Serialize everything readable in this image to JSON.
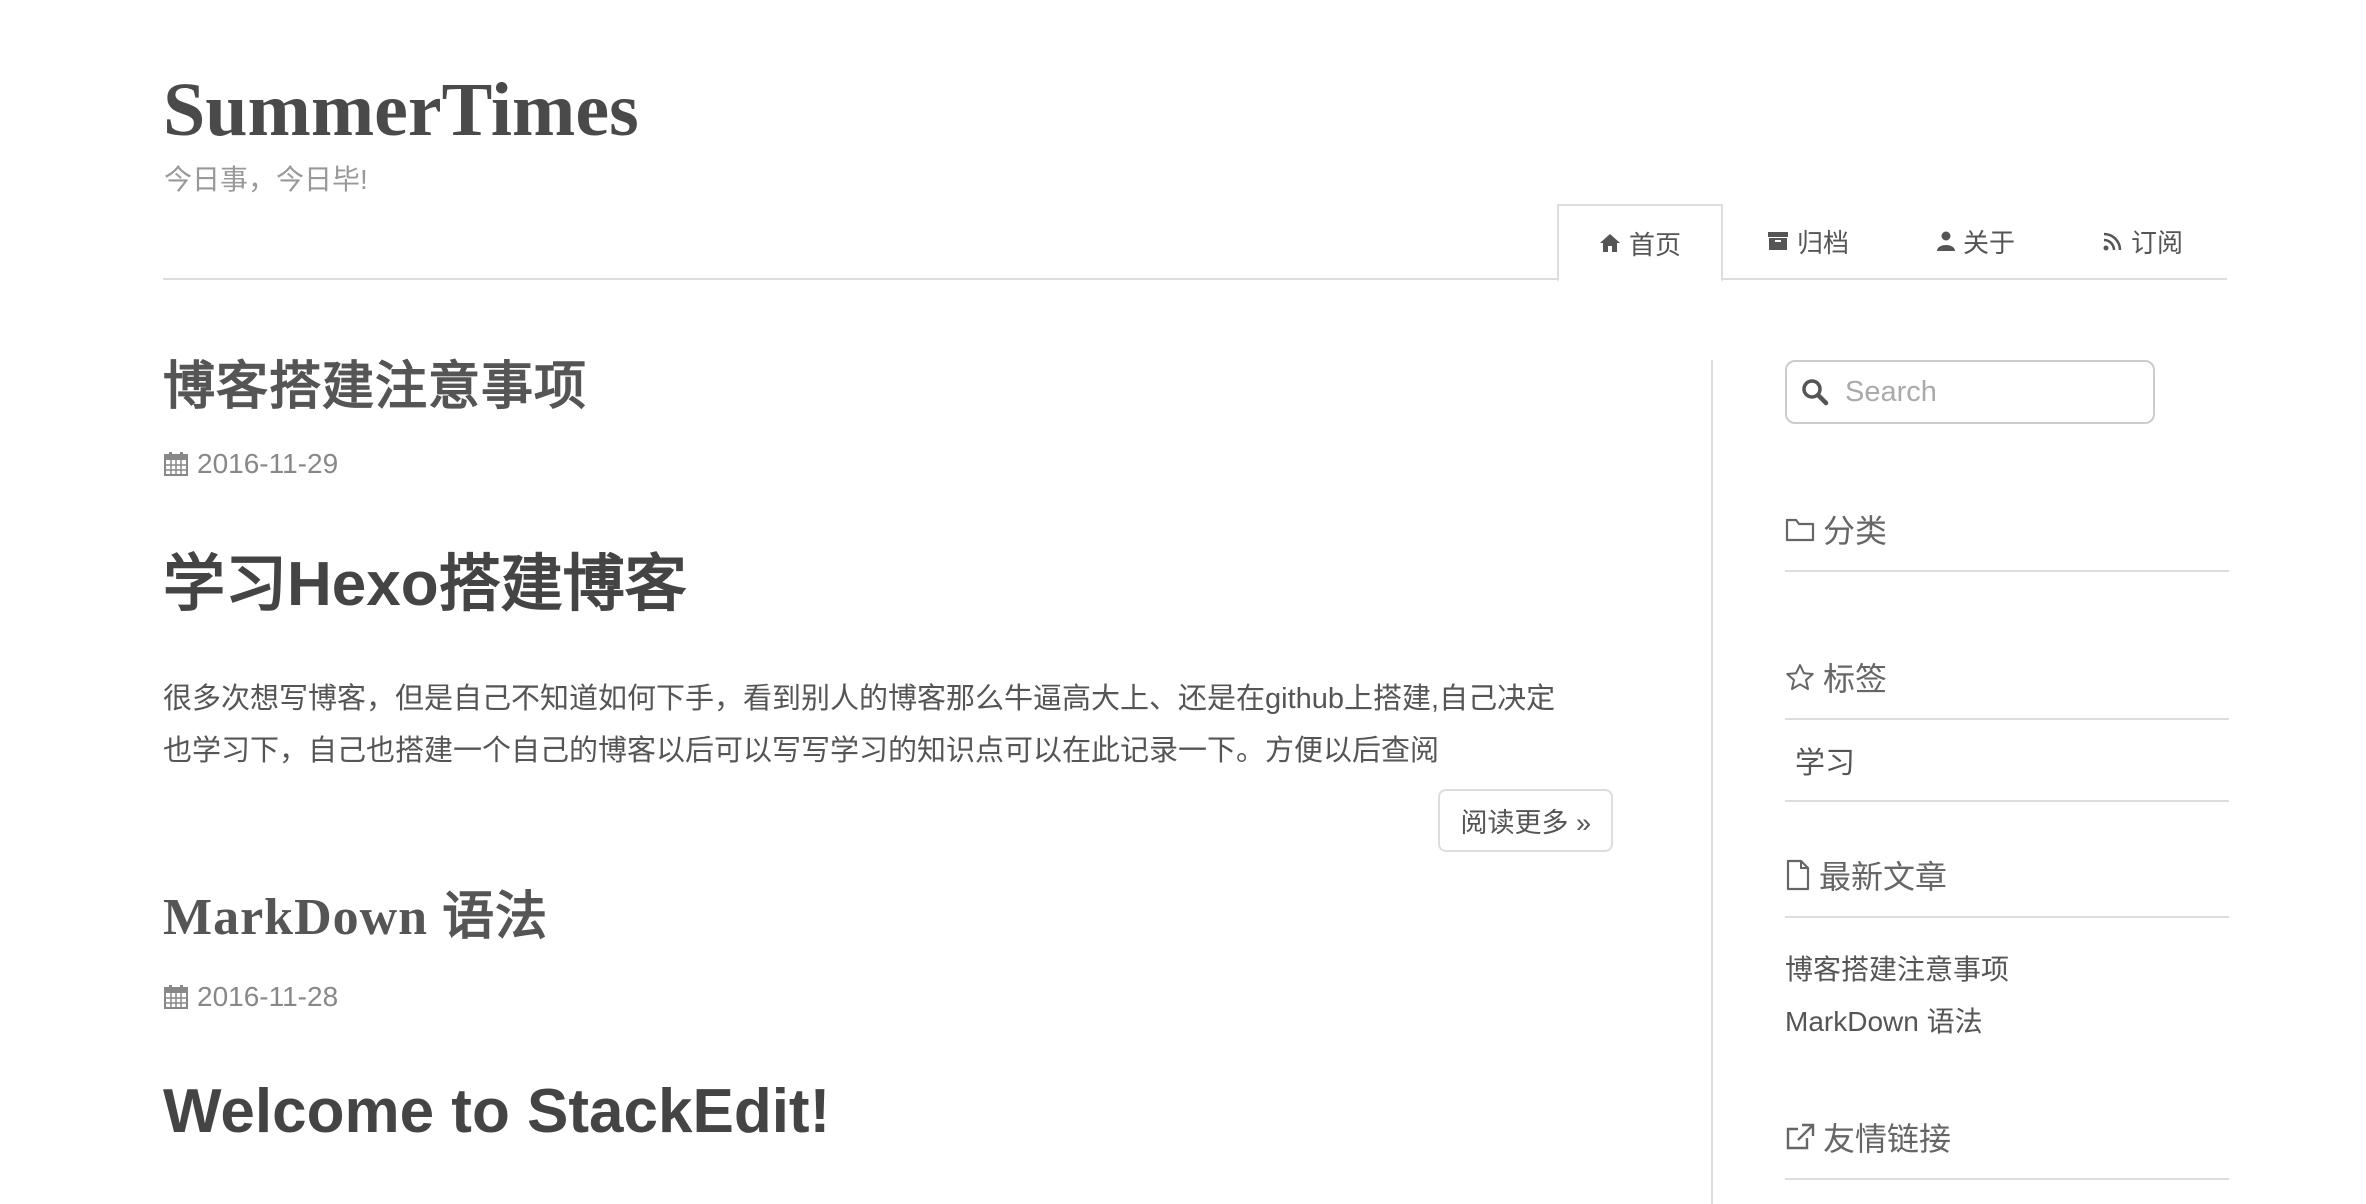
{
  "site": {
    "title": "SummerTimes",
    "subtitle": "今日事，今日毕!"
  },
  "nav": {
    "items": [
      {
        "label": "首页",
        "icon": "home-icon"
      },
      {
        "label": "归档",
        "icon": "archive-icon"
      },
      {
        "label": "关于",
        "icon": "user-icon"
      },
      {
        "label": "订阅",
        "icon": "rss-icon"
      }
    ]
  },
  "posts": [
    {
      "title": "博客搭建注意事项",
      "date": "2016-11-29",
      "heading": "学习Hexo搭建博客",
      "excerpt_line1": "很多次想写博客，但是自己不知道如何下手，看到别人的博客那么牛逼高大上、还是在github上搭建,自己决定",
      "excerpt_line2": "也学习下，自己也搭建一个自己的博客以后可以写写学习的知识点可以在此记录一下。方便以后查阅",
      "read_more": "阅读更多 »"
    },
    {
      "title": "MarkDown 语法",
      "date": "2016-11-28",
      "heading": "Welcome to StackEdit!"
    }
  ],
  "sidebar": {
    "search_placeholder": "Search",
    "categories_title": "分类",
    "tags_title": "标签",
    "tags": [
      "学习"
    ],
    "recent_title": "最新文章",
    "recent": [
      "博客搭建注意事项",
      "MarkDown 语法"
    ],
    "links_title": "友情链接"
  },
  "colors": {
    "text": "#555555",
    "muted": "#999999",
    "border": "#dddddd"
  }
}
